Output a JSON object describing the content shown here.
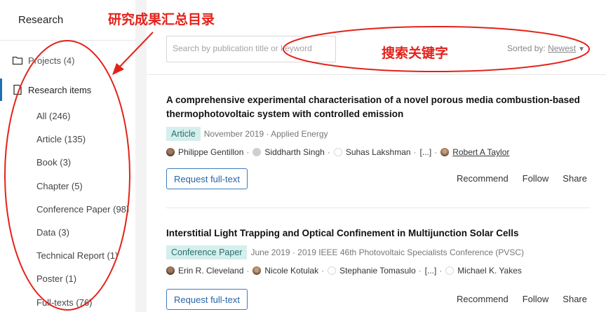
{
  "sidebar": {
    "title": "Research",
    "projects_label": "Projects (4)",
    "research_items_label": "Research items",
    "items": [
      "All (246)",
      "Article (135)",
      "Book (3)",
      "Chapter (5)",
      "Conference Paper (98)",
      "Data (3)",
      "Technical Report (1)",
      "Poster (1)",
      "Full-texts (76)"
    ]
  },
  "search": {
    "placeholder": "Search by publication title or keyword"
  },
  "sort": {
    "label": "Sorted by: ",
    "value": "Newest"
  },
  "publications": [
    {
      "title": "A comprehensive experimental characterisation of a novel porous media combustion-based thermophotovoltaic system with controlled emission",
      "type": "Article",
      "meta": "November 2019 · Applied Energy",
      "authors": [
        "Philippe Gentillon",
        "Siddharth Singh",
        "Suhas Lakshman",
        "[...]",
        "Robert A Taylor"
      ],
      "request_label": "Request full-text",
      "actions": [
        "Recommend",
        "Follow",
        "Share"
      ]
    },
    {
      "title": "Interstitial Light Trapping and Optical Confinement in Multijunction Solar Cells",
      "type": "Conference Paper",
      "meta": "June 2019 · 2019 IEEE 46th Photovoltaic Specialists Conference (PVSC)",
      "authors": [
        "Erin R. Cleveland",
        "Nicole Kotulak",
        "Stephanie Tomasulo",
        "[...]",
        "Michael K. Yakes"
      ],
      "request_label": "Request full-text",
      "actions": [
        "Recommend",
        "Follow",
        "Share"
      ]
    }
  ],
  "annotations": {
    "catalog": "研究成果汇总目录",
    "keywords": "搜索关键字",
    "color": "#e3221b"
  }
}
